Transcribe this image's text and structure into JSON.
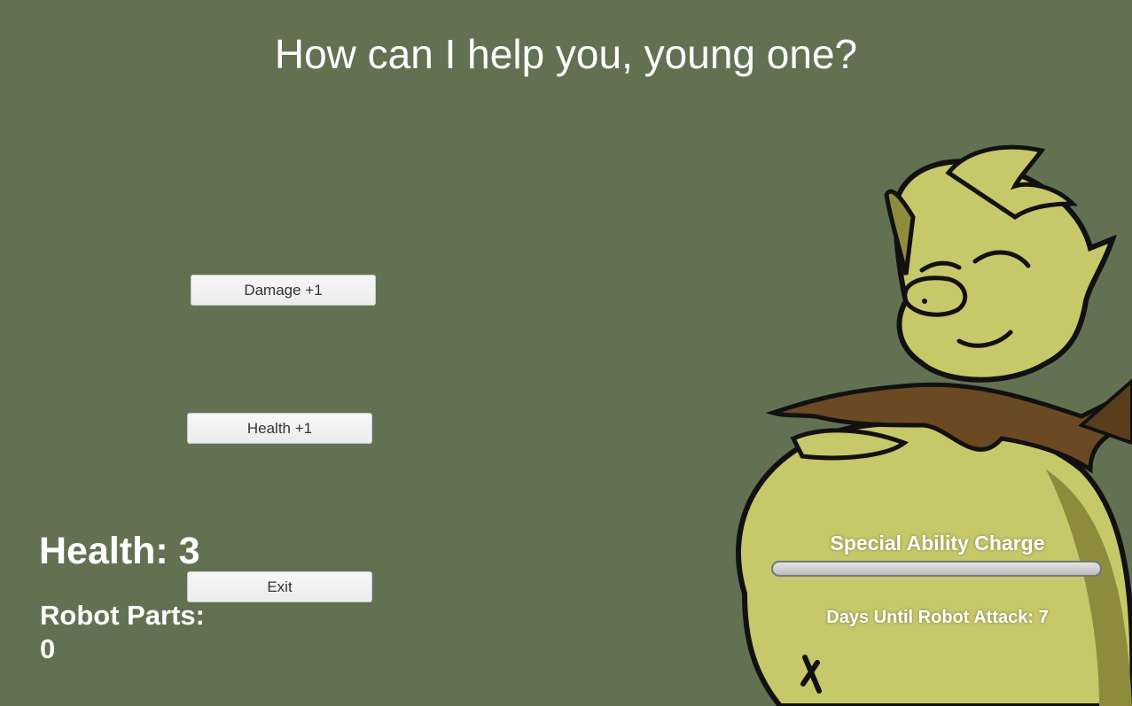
{
  "dialog": {
    "prompt": "How can I help you, young one?"
  },
  "buttons": {
    "damage_label": "Damage +1",
    "health_label": "Health +1",
    "exit_label": "Exit"
  },
  "stats": {
    "health_text": "Health: 3",
    "robot_parts_label": "Robot Parts:",
    "robot_parts_value": "0"
  },
  "special_ability": {
    "label": "Special Ability Charge",
    "charge_fraction": 1.0
  },
  "robot_attack": {
    "text": "Days Until Robot Attack: 7"
  },
  "colors": {
    "background": "#637153",
    "creature_skin": "#c6c86a",
    "creature_shadow": "#8e8c3c",
    "scarf": "#6b4a23",
    "text": "#ffffff"
  },
  "character": {
    "icon": "elder-creature-portrait"
  }
}
